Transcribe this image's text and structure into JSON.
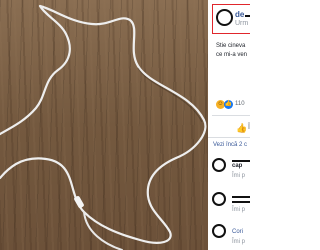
{
  "post": {
    "author_name": "de",
    "follow_label": "Urm",
    "text_line1": "Stie cineva",
    "text_line2": "ce mi-a ven",
    "reaction_count": "110",
    "like_label": "Îi",
    "reaction_icons": [
      "haha-icon",
      "like-icon"
    ]
  },
  "comments": {
    "view_more_label": "Vezi încă 2 c",
    "items": [
      {
        "name": "cap",
        "sub": "Îmi p"
      },
      {
        "name": "",
        "sub": "Îmi p"
      },
      {
        "name": "Cori",
        "sub": "Îmi p"
      }
    ]
  },
  "colors": {
    "highlight_border": "#e0262c",
    "link": "#385898",
    "like_blue": "#1877f2",
    "photo_background": "#7d6349",
    "cable": "#eeeeee"
  }
}
